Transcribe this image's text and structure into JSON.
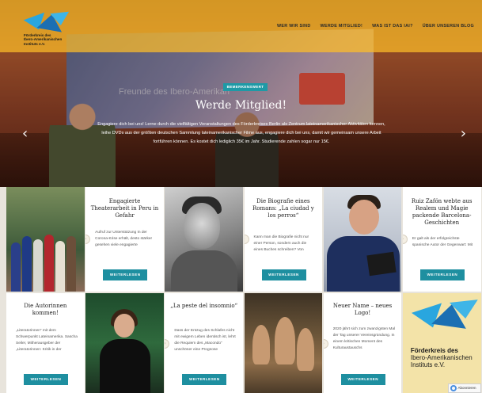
{
  "site": {
    "logo_line1": "Förderkreis des",
    "logo_line2": "Ibero-Amerikanischen",
    "logo_line3": "Instituts e.V."
  },
  "nav": [
    "WER WIR SIND",
    "WERDE MITGLIED!",
    "WAS IST DAS IAI?",
    "ÜBER UNSEREN BLOG"
  ],
  "hero": {
    "badge": "BEMERKENSWERT",
    "title": "Werde Mitglied!",
    "text": "Engagiere dich bei uns! Lerne durch die vielfältigen Veranstaltungen des Förderkreises Berlin als Zentrum lateinamerikanischer Aktivitäten kennen, leihe DVDs aus der größten deutschen Sammlung lateinamerikanischer Filme aus, engagiere dich bei uns, damit wir gemeinsam unsere Arbeit fortführen können. Es kostet dich lediglich 35€ im Jahr. Studierende zahlen sogar nur 15€.",
    "screen_text": "Freunde des Ibero-Amerikan",
    "prev": "‹",
    "next": "›"
  },
  "cards": [
    {
      "title": "Engagierte Theaterarbeit in Peru in Gefahr",
      "text": "Aufruf zur Unterstützung In der Corona-Krise erhält, desto stärker gesehen viele engagierte",
      "button": "WEITERLESEN"
    },
    {
      "title": "Die Biografie eines Romans: „La ciudad y los perros“",
      "text": "Kann man die Biografie nicht nur einer Person, sondern auch die eines Buches schreiben? Von",
      "button": "WEITERLESEN"
    },
    {
      "title": "Ruiz Zafón webte aus Realem und Magie packende Barcelona-Geschichten",
      "text": "Er galt als der erfolgreichste spanische Autor der Gegenwart: Mit",
      "button": "WEITERLESEN"
    },
    {
      "title": "Die Autorinnen kommen!",
      "text": "„Literatorinnen“ mit dem Schwerpunkt Lateinamerika. Sascha Seiler, Mitherausgeber der „Literatorinnen: Kritik in der",
      "button": "WEITERLESEN"
    },
    {
      "title": "„La peste del insomnio“",
      "text": "Dass der Entzug des Schlafes nicht mit ewigem Leben identisch ist, lehrt die Requiem des „Macondo“ unschöner eine Prognose",
      "button": "WEITERLESEN"
    },
    {
      "title": "Neuer Name – neues Logo!",
      "text": "2020 jährt sich zum zwanzigsten Mal der Tag unserer Vereinsgründung. In einem kritischen Moment des Kulturaustauschs",
      "button": "WEITERLESEN"
    }
  ],
  "logo_tile": {
    "line1": "Förderkreis des",
    "line2": "Ibero-Amerikanischen",
    "line3": "Instituts e.V."
  },
  "recaptcha": "Abonnieren",
  "colors": {
    "header": "#ffbe28",
    "accent": "#1e8fa0",
    "logo_blue": "#1b6fb3",
    "logo_light": "#29a6df"
  }
}
